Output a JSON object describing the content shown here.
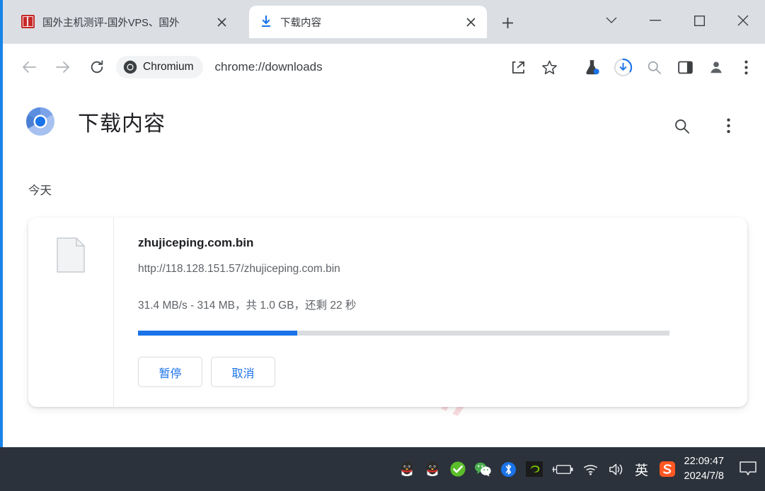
{
  "window": {
    "controls": [
      {
        "name": "tab-search",
        "glyph": "chevron-down"
      },
      {
        "name": "minimize",
        "glyph": "minus"
      },
      {
        "name": "maximize",
        "glyph": "square"
      },
      {
        "name": "close",
        "glyph": "x"
      }
    ]
  },
  "tabs": [
    {
      "title": "国外主机测评-国外VPS、国外",
      "favicon": "red-seal-icon",
      "active": false
    },
    {
      "title": "下载内容",
      "favicon": "download-icon",
      "active": true
    }
  ],
  "newtab_label": "+",
  "toolbar": {
    "back_icon": "back-arrow-icon",
    "forward_icon": "forward-arrow-icon",
    "reload_icon": "reload-icon",
    "chip_label": "Chromium",
    "url": "chrome://downloads",
    "icons": [
      {
        "name": "share-icon"
      },
      {
        "name": "bookmark-star-icon"
      },
      {
        "name": "experiments-flask-icon"
      },
      {
        "name": "download-progress-icon"
      },
      {
        "name": "search-icon"
      },
      {
        "name": "side-panel-icon"
      },
      {
        "name": "profile-avatar-icon"
      },
      {
        "name": "more-menu-icon"
      }
    ]
  },
  "page": {
    "logo": "chromium-logo",
    "title": "下载内容",
    "search_icon": "search-icon",
    "menu_icon": "more-menu-icon",
    "section_label": "今天",
    "watermark": "zhujiceping.com"
  },
  "download": {
    "file_icon": "generic-file-icon",
    "file_name": "zhujiceping.com.bin",
    "url": "http://118.128.151.57/zhujiceping.com.bin",
    "status": "31.4 MB/s - 314 MB，共 1.0 GB，还剩 22 秒",
    "progress_percent": 30,
    "progress_color": "#1a73e8",
    "pause_label": "暂停",
    "cancel_label": "取消"
  },
  "taskbar": {
    "tray": [
      {
        "name": "qq-icon"
      },
      {
        "name": "qq-icon-2"
      },
      {
        "name": "security-check-icon"
      },
      {
        "name": "wechat-icon"
      },
      {
        "name": "bluetooth-icon"
      },
      {
        "name": "nvidia-icon"
      },
      {
        "name": "battery-icon"
      },
      {
        "name": "wifi-icon"
      },
      {
        "name": "volume-icon"
      },
      {
        "name": "ime-indicator"
      },
      {
        "name": "sogou-icon"
      }
    ],
    "ime_label": "英",
    "sogou_label": "S",
    "time": "22:09:47",
    "date": "2024/7/8",
    "notification_icon": "notification-bubble-icon"
  }
}
